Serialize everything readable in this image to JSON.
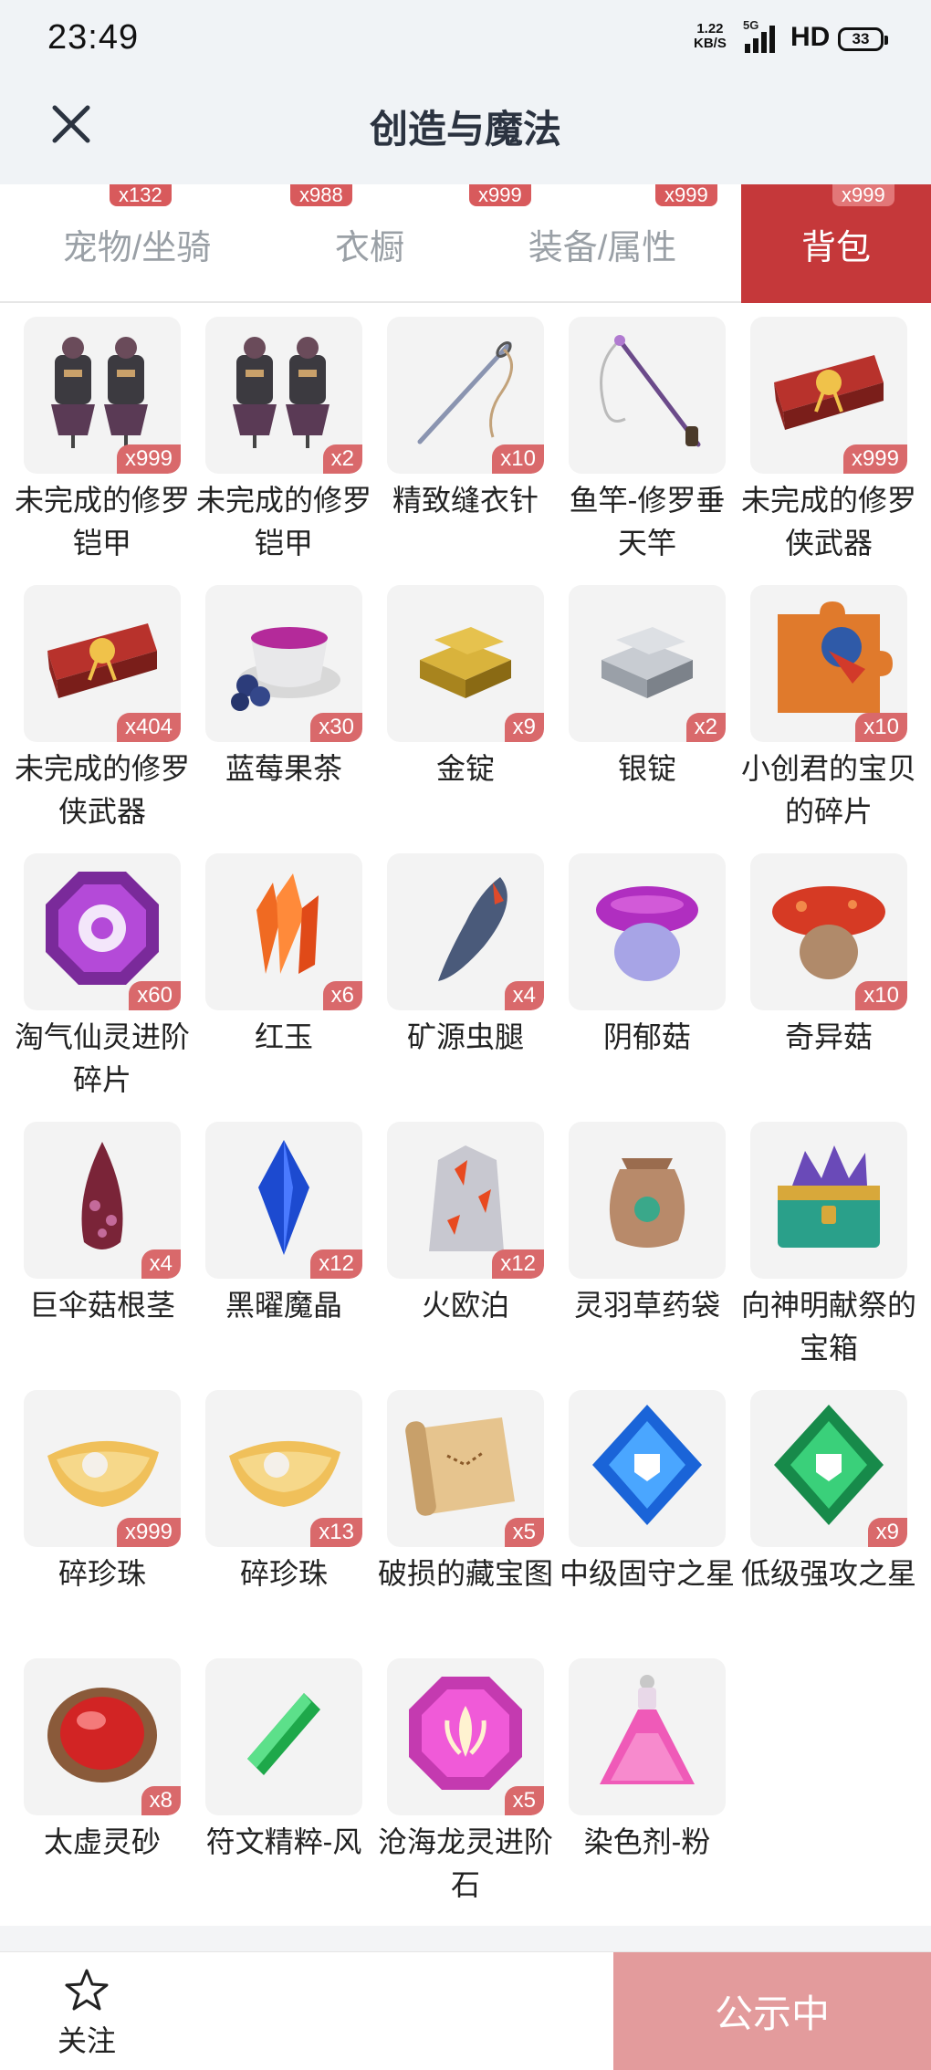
{
  "status": {
    "time": "23:49",
    "net_speed": "1.22",
    "net_unit": "KB/S",
    "net_type": "5G",
    "hd": "HD",
    "battery": "33"
  },
  "header": {
    "title": "创造与魔法",
    "close_icon": "close-icon"
  },
  "tabs": [
    {
      "label": "宠物/坐骑",
      "badge": "x132",
      "active": false
    },
    {
      "label": "衣橱",
      "badge": "x988",
      "active": false
    },
    {
      "label": "装备/属性",
      "badge": "x999",
      "active": false
    },
    {
      "label": "",
      "badge": "x999",
      "active": false
    },
    {
      "label": "背包",
      "badge": "x999",
      "active": true
    }
  ],
  "items": [
    {
      "name": "未完成的修罗铠甲",
      "count": "x999",
      "icon": "armor-icon"
    },
    {
      "name": "未完成的修罗铠甲",
      "count": "x2",
      "icon": "armor-icon"
    },
    {
      "name": "精致缝衣针",
      "count": "x10",
      "icon": "needle-icon"
    },
    {
      "name": "鱼竿-修罗垂天竿",
      "count": "",
      "icon": "fishing-rod-icon"
    },
    {
      "name": "未完成的修罗侠武器",
      "count": "x999",
      "icon": "weapon-box-icon"
    },
    {
      "name": "未完成的修罗侠武器",
      "count": "x404",
      "icon": "weapon-box-icon"
    },
    {
      "name": "蓝莓果茶",
      "count": "x30",
      "icon": "tea-icon"
    },
    {
      "name": "金锭",
      "count": "x9",
      "icon": "gold-ingot-icon"
    },
    {
      "name": "银锭",
      "count": "x2",
      "icon": "silver-ingot-icon"
    },
    {
      "name": "小创君的宝贝的碎片",
      "count": "x10",
      "icon": "puzzle-piece-icon"
    },
    {
      "name": "淘气仙灵进阶碎片",
      "count": "x60",
      "icon": "purple-gem-icon"
    },
    {
      "name": "红玉",
      "count": "x6",
      "icon": "red-crystal-icon"
    },
    {
      "name": "矿源虫腿",
      "count": "x4",
      "icon": "insect-leg-icon"
    },
    {
      "name": "阴郁菇",
      "count": "",
      "icon": "purple-mushroom-icon"
    },
    {
      "name": "奇异菇",
      "count": "x10",
      "icon": "red-mushroom-icon"
    },
    {
      "name": "巨伞菇根茎",
      "count": "x4",
      "icon": "mushroom-stem-icon"
    },
    {
      "name": "黑曜魔晶",
      "count": "x12",
      "icon": "blue-crystal-icon"
    },
    {
      "name": "火欧泊",
      "count": "x12",
      "icon": "fire-opal-icon"
    },
    {
      "name": "灵羽草药袋",
      "count": "",
      "icon": "herb-bag-icon"
    },
    {
      "name": "向神明献祭的宝箱",
      "count": "",
      "icon": "treasure-chest-icon"
    },
    {
      "name": "碎珍珠",
      "count": "x999",
      "icon": "pearl-shell-icon"
    },
    {
      "name": "碎珍珠",
      "count": "x13",
      "icon": "pearl-shell-icon"
    },
    {
      "name": "破损的藏宝图",
      "count": "x5",
      "icon": "treasure-map-icon"
    },
    {
      "name": "中级固守之星",
      "count": "",
      "icon": "blue-star-icon"
    },
    {
      "name": "低级强攻之星",
      "count": "x9",
      "icon": "green-star-icon"
    },
    {
      "name": "太虚灵砂",
      "count": "x8",
      "icon": "red-stone-icon"
    },
    {
      "name": "符文精粹-风",
      "count": "",
      "icon": "green-rune-icon"
    },
    {
      "name": "沧海龙灵进阶石",
      "count": "x5",
      "icon": "pink-gem-icon"
    },
    {
      "name": "染色剂-粉",
      "count": "",
      "icon": "pink-potion-icon"
    }
  ],
  "bottom": {
    "follow_label": "关注",
    "follow_icon": "star-icon",
    "public_label": "公示中"
  },
  "colors": {
    "accent": "#c5383a",
    "badge": "#d9696b",
    "public_button": "#e39b9c"
  }
}
